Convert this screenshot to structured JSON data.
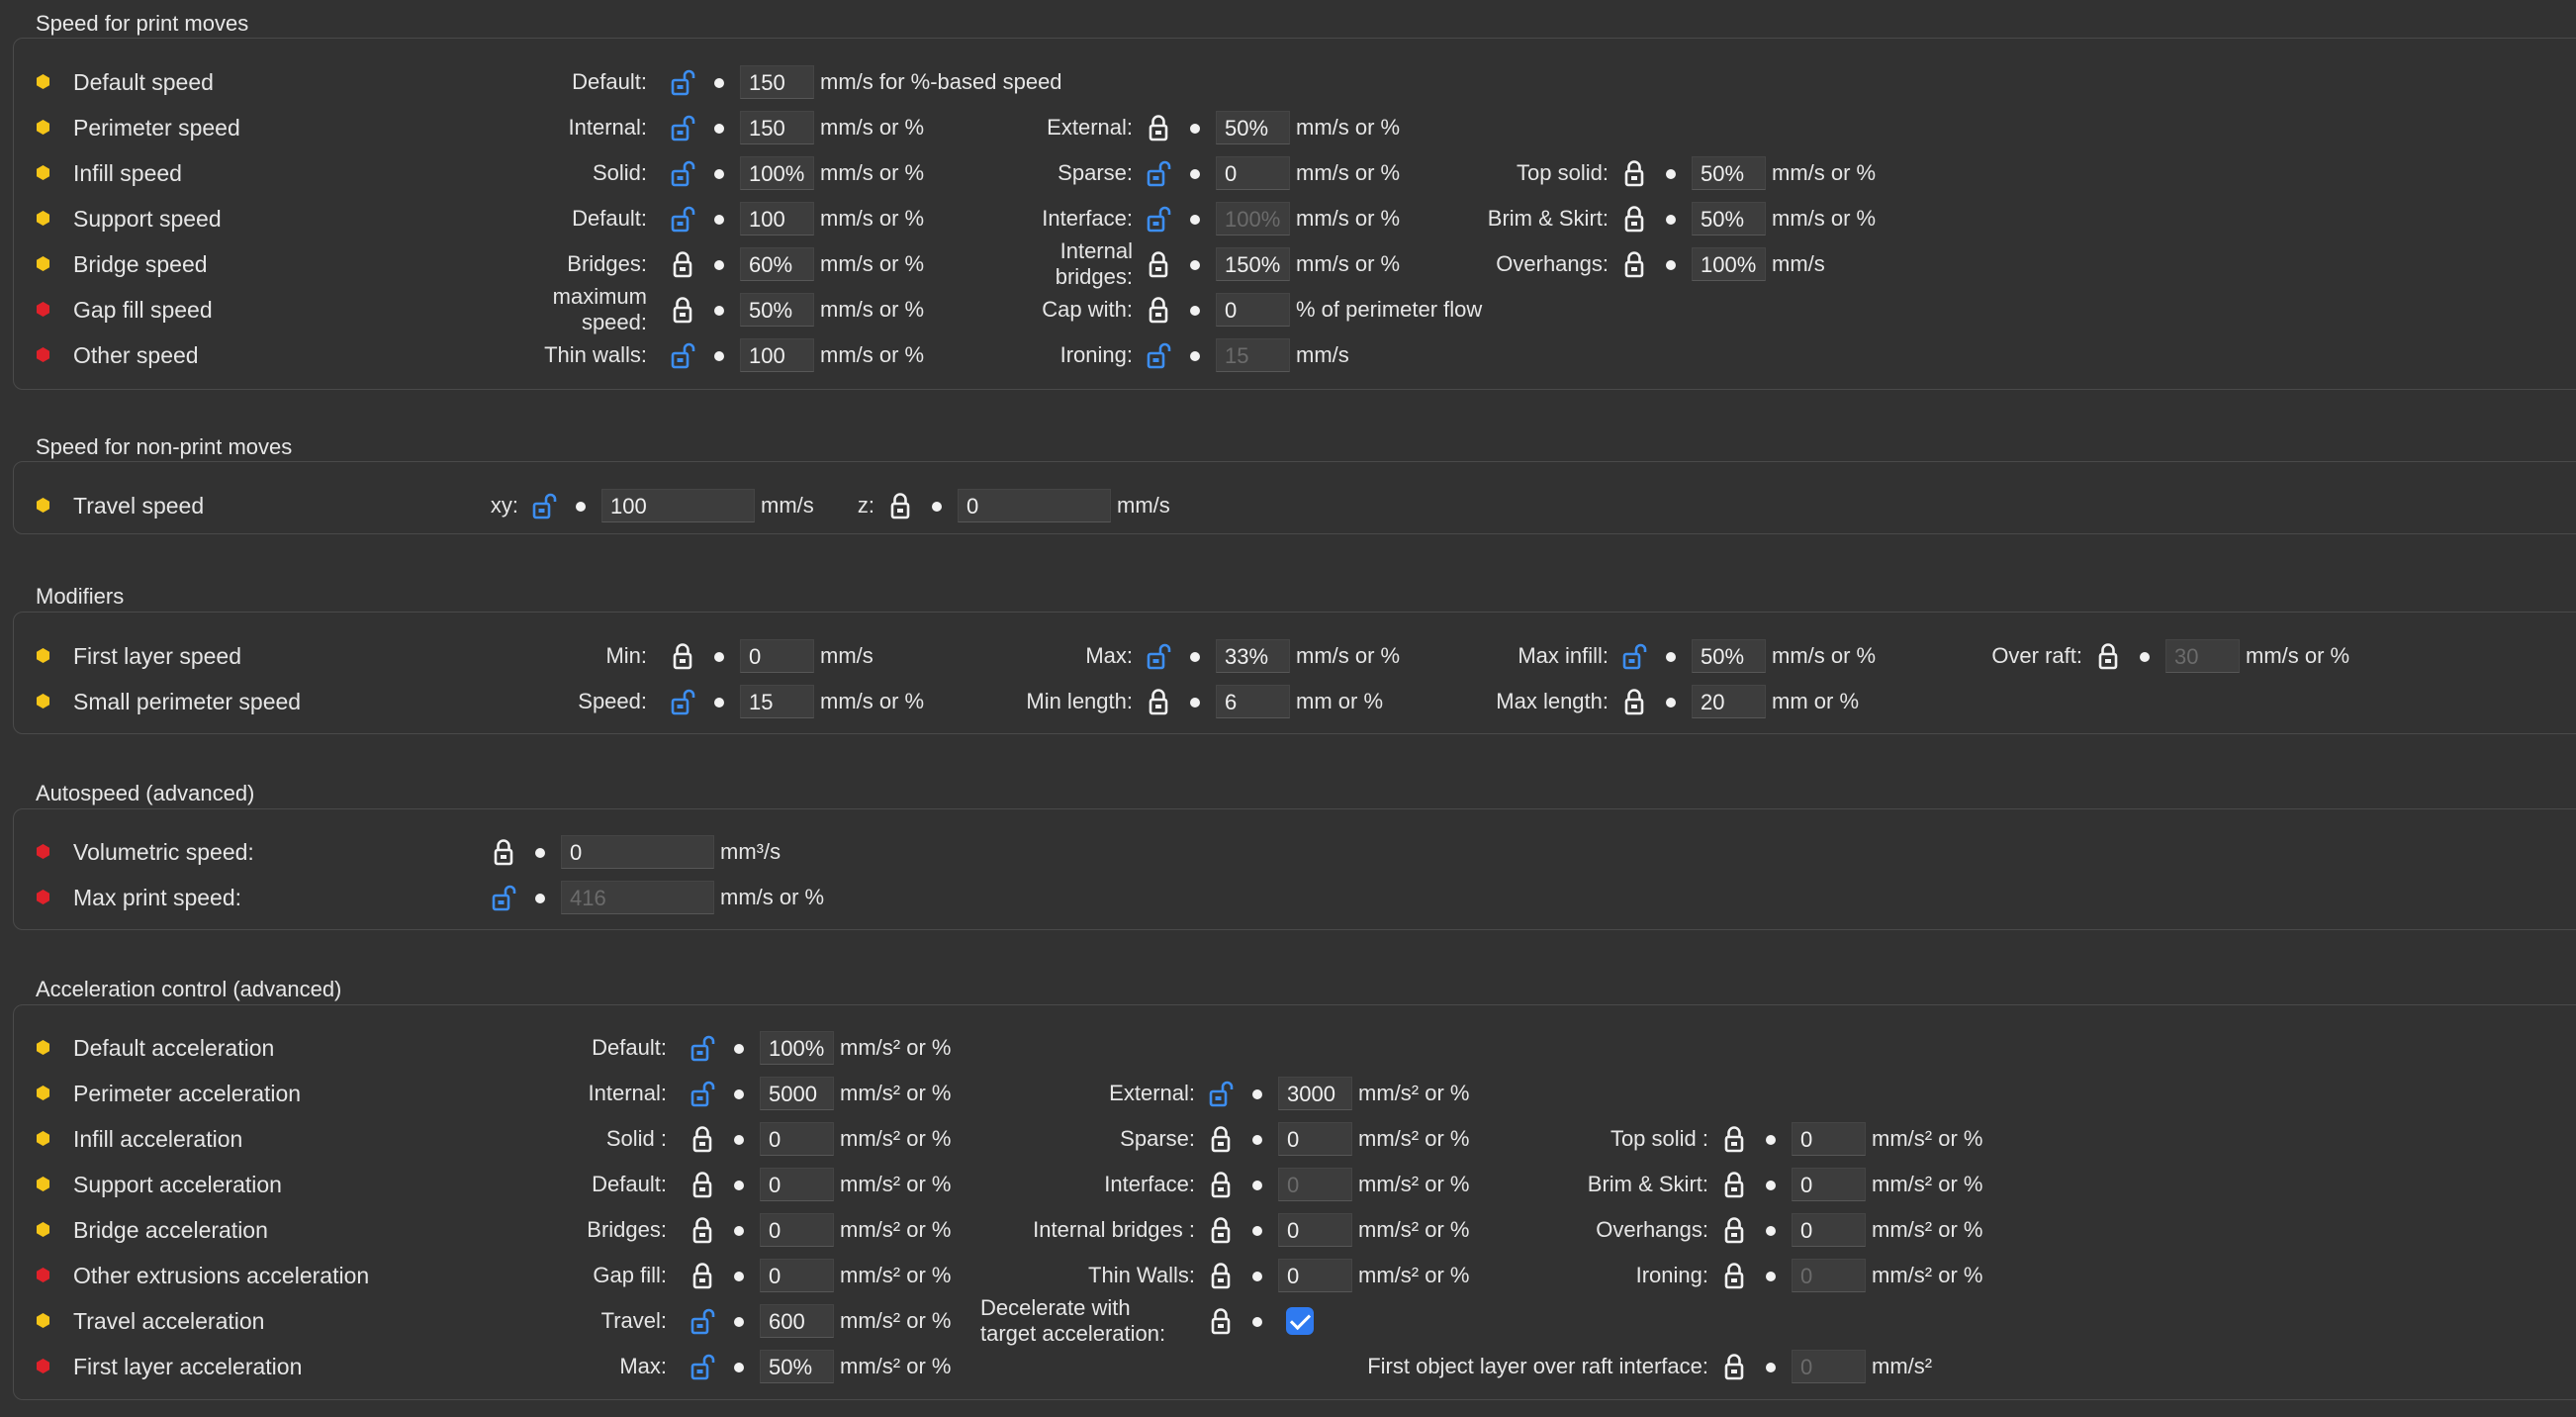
{
  "colors": {
    "yellow": "#f5c518",
    "red": "#e0212a",
    "lock_open": "#3d8ef0",
    "lock_closed": "#f2f2f2",
    "check": "#2f7af0"
  },
  "sections": [
    {
      "title": "Speed for print moves",
      "rows": [
        {
          "dot": "yellow",
          "label": "Default speed",
          "fields": [
            {
              "label": "Default:",
              "lock": "open",
              "value": "150",
              "unit": "mm/s for %-based speed"
            }
          ]
        },
        {
          "dot": "yellow",
          "label": "Perimeter speed",
          "fields": [
            {
              "label": "Internal:",
              "lock": "open",
              "value": "150",
              "unit": "mm/s or %"
            },
            {
              "label": "External:",
              "lock": "closed",
              "value": "50%",
              "unit": "mm/s or %"
            }
          ]
        },
        {
          "dot": "yellow",
          "label": "Infill speed",
          "fields": [
            {
              "label": "Solid:",
              "lock": "open",
              "value": "100%",
              "unit": "mm/s or %"
            },
            {
              "label": "Sparse:",
              "lock": "open",
              "value": "0",
              "unit": "mm/s or %"
            },
            {
              "label": "Top solid:",
              "lock": "closed",
              "value": "50%",
              "unit": "mm/s or %"
            }
          ]
        },
        {
          "dot": "yellow",
          "label": "Support speed",
          "fields": [
            {
              "label": "Default:",
              "lock": "open",
              "value": "100",
              "unit": "mm/s or %"
            },
            {
              "label": "Interface:",
              "lock": "open",
              "value": "100%",
              "unit": "mm/s or %",
              "disabled": true
            },
            {
              "label": "Brim & Skirt:",
              "lock": "closed",
              "value": "50%",
              "unit": "mm/s or %"
            }
          ]
        },
        {
          "dot": "yellow",
          "label": "Bridge speed",
          "fields": [
            {
              "label": "Bridges:",
              "lock": "closed",
              "value": "60%",
              "unit": "mm/s or %"
            },
            {
              "label": "Internal bridges:",
              "lock": "closed",
              "value": "150%",
              "unit": "mm/s or %"
            },
            {
              "label": "Overhangs:",
              "lock": "closed",
              "value": "100%",
              "unit": "mm/s"
            }
          ]
        },
        {
          "dot": "red",
          "label": "Gap fill speed",
          "fields": [
            {
              "label": "maximum speed:",
              "lock": "closed",
              "value": "50%",
              "unit": "mm/s or %"
            },
            {
              "label": "Cap with:",
              "lock": "closed",
              "value": "0",
              "unit": "% of perimeter flow"
            }
          ]
        },
        {
          "dot": "red",
          "label": "Other speed",
          "fields": [
            {
              "label": "Thin walls:",
              "lock": "open",
              "value": "100",
              "unit": "mm/s or %"
            },
            {
              "label": "Ironing:",
              "lock": "open",
              "value": "15",
              "unit": "mm/s",
              "disabled": true
            }
          ]
        }
      ]
    },
    {
      "title": "Speed for non-print moves",
      "rows": [
        {
          "dot": "yellow",
          "label": "Travel speed",
          "fields": [
            {
              "label": "xy:",
              "lock": "open",
              "value": "100",
              "unit": "mm/s"
            },
            {
              "label": "z:",
              "lock": "closed",
              "value": "0",
              "unit": "mm/s"
            }
          ]
        }
      ]
    },
    {
      "title": "Modifiers",
      "rows": [
        {
          "dot": "yellow",
          "label": "First layer speed",
          "fields": [
            {
              "label": "Min:",
              "lock": "closed",
              "value": "0",
              "unit": "mm/s"
            },
            {
              "label": "Max:",
              "lock": "open",
              "value": "33%",
              "unit": "mm/s or %"
            },
            {
              "label": "Max infill:",
              "lock": "open",
              "value": "50%",
              "unit": "mm/s or %"
            },
            {
              "label": "Over raft:",
              "lock": "closed",
              "value": "30",
              "unit": "mm/s or %",
              "disabled": true
            }
          ]
        },
        {
          "dot": "yellow",
          "label": "Small perimeter speed",
          "fields": [
            {
              "label": "Speed:",
              "lock": "open",
              "value": "15",
              "unit": "mm/s or %"
            },
            {
              "label": "Min length:",
              "lock": "closed",
              "value": "6",
              "unit": "mm or %"
            },
            {
              "label": "Max length:",
              "lock": "closed",
              "value": "20",
              "unit": "mm or %"
            }
          ]
        }
      ]
    },
    {
      "title": "Autospeed (advanced)",
      "rows": [
        {
          "dot": "red",
          "label": "Volumetric speed:",
          "fields": [
            {
              "label": "",
              "lock": "closed",
              "value": "0",
              "unit": "mm³/s"
            }
          ]
        },
        {
          "dot": "red",
          "label": "Max print speed:",
          "fields": [
            {
              "label": "",
              "lock": "open",
              "value": "416",
              "unit": "mm/s or %",
              "disabled": true
            }
          ]
        }
      ]
    },
    {
      "title": "Acceleration control (advanced)",
      "rows": [
        {
          "dot": "yellow",
          "label": "Default acceleration",
          "fields": [
            {
              "label": "Default:",
              "lock": "open",
              "value": "100%",
              "unit": "mm/s² or %"
            }
          ]
        },
        {
          "dot": "yellow",
          "label": "Perimeter acceleration",
          "fields": [
            {
              "label": "Internal:",
              "lock": "open",
              "value": "5000",
              "unit": "mm/s² or %"
            },
            {
              "label": "External:",
              "lock": "open",
              "value": "3000",
              "unit": "mm/s² or %"
            }
          ]
        },
        {
          "dot": "yellow",
          "label": "Infill acceleration",
          "fields": [
            {
              "label": "Solid :",
              "lock": "closed",
              "value": "0",
              "unit": "mm/s² or %"
            },
            {
              "label": "Sparse:",
              "lock": "closed",
              "value": "0",
              "unit": "mm/s² or %"
            },
            {
              "label": "Top solid :",
              "lock": "closed",
              "value": "0",
              "unit": "mm/s² or %"
            }
          ]
        },
        {
          "dot": "yellow",
          "label": "Support acceleration",
          "fields": [
            {
              "label": "Default:",
              "lock": "closed",
              "value": "0",
              "unit": "mm/s² or %"
            },
            {
              "label": "Interface:",
              "lock": "closed",
              "value": "0",
              "unit": "mm/s² or %",
              "disabled": true
            },
            {
              "label": "Brim & Skirt:",
              "lock": "closed",
              "value": "0",
              "unit": "mm/s² or %"
            }
          ]
        },
        {
          "dot": "yellow",
          "label": "Bridge acceleration",
          "fields": [
            {
              "label": "Bridges:",
              "lock": "closed",
              "value": "0",
              "unit": "mm/s² or %"
            },
            {
              "label": "Internal bridges :",
              "lock": "closed",
              "value": "0",
              "unit": "mm/s² or %"
            },
            {
              "label": "Overhangs:",
              "lock": "closed",
              "value": "0",
              "unit": "mm/s² or %"
            }
          ]
        },
        {
          "dot": "red",
          "label": "Other extrusions acceleration",
          "fields": [
            {
              "label": "Gap fill:",
              "lock": "closed",
              "value": "0",
              "unit": "mm/s² or %"
            },
            {
              "label": "Thin Walls:",
              "lock": "closed",
              "value": "0",
              "unit": "mm/s² or %"
            },
            {
              "label": "Ironing:",
              "lock": "closed",
              "value": "0",
              "unit": "mm/s² or %",
              "disabled": true
            }
          ]
        },
        {
          "dot": "yellow",
          "label": "Travel acceleration",
          "fields": [
            {
              "label": "Travel:",
              "lock": "open",
              "value": "600",
              "unit": "mm/s² or %"
            },
            {
              "label": "Decelerate with target acceleration:",
              "lock": "closed",
              "checkbox": true,
              "checked": true
            }
          ]
        },
        {
          "dot": "red",
          "label": "First layer acceleration",
          "fields": [
            {
              "label": "Max:",
              "lock": "open",
              "value": "50%",
              "unit": "mm/s² or %"
            },
            {
              "label": "First object layer over raft interface:",
              "lock": "closed",
              "value": "0",
              "unit": "mm/s²",
              "disabled": true
            }
          ]
        }
      ]
    }
  ]
}
